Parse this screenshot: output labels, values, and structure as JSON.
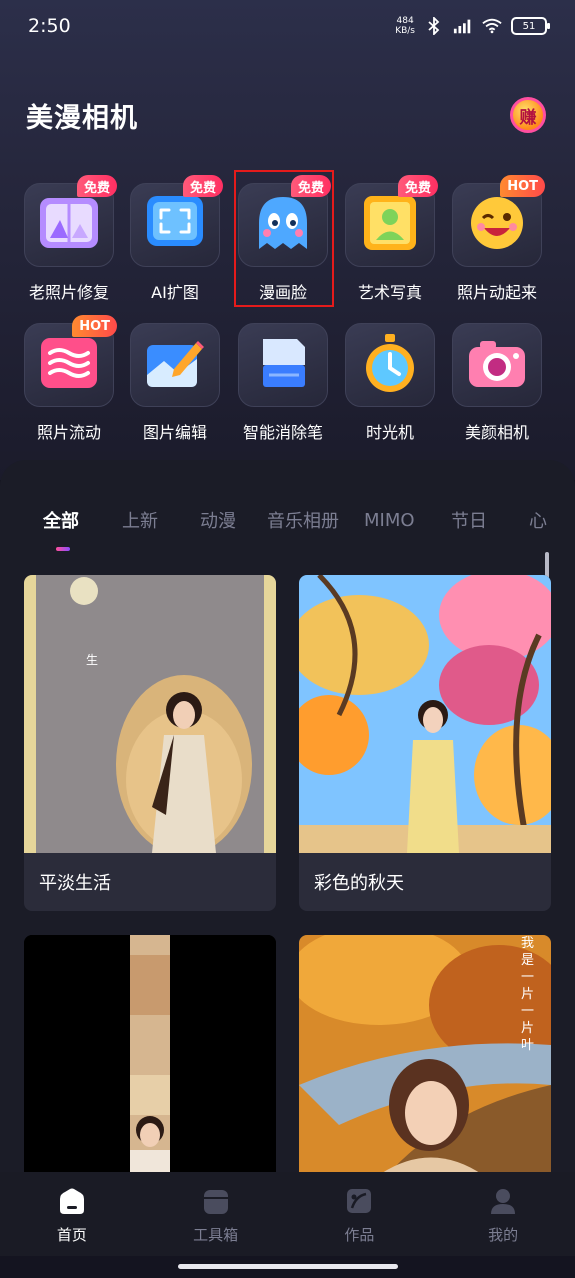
{
  "status_bar": {
    "time": "2:50",
    "net_speed_value": "484",
    "net_speed_unit": "KB/s",
    "battery": "51"
  },
  "app": {
    "title": "美漫相机",
    "earn_label": "赚"
  },
  "tools": [
    {
      "label": "老照片修复",
      "tag": "免费",
      "tag_type": "free",
      "icon": "old-photo-icon"
    },
    {
      "label": "AI扩图",
      "tag": "免费",
      "tag_type": "free",
      "icon": "expand-icon"
    },
    {
      "label": "漫画脸",
      "tag": "免费",
      "tag_type": "free",
      "icon": "ghost-icon"
    },
    {
      "label": "艺术写真",
      "tag": "免费",
      "tag_type": "free",
      "icon": "portrait-frame-icon"
    },
    {
      "label": "照片动起来",
      "tag": "HOT",
      "tag_type": "hot",
      "icon": "wink-face-icon"
    },
    {
      "label": "照片流动",
      "tag": "HOT",
      "tag_type": "hot",
      "icon": "waves-icon"
    },
    {
      "label": "图片编辑",
      "tag": "",
      "tag_type": "",
      "icon": "pencil-edit-icon"
    },
    {
      "label": "智能消除笔",
      "tag": "",
      "tag_type": "",
      "icon": "eraser-icon"
    },
    {
      "label": "时光机",
      "tag": "",
      "tag_type": "",
      "icon": "stopwatch-icon"
    },
    {
      "label": "美颜相机",
      "tag": "",
      "tag_type": "",
      "icon": "camera-icon"
    }
  ],
  "tabs": [
    "全部",
    "上新",
    "动漫",
    "音乐相册",
    "MIMO",
    "节日",
    "心"
  ],
  "active_tab": "全部",
  "cards": [
    {
      "title": "平淡生活"
    },
    {
      "title": "彩色的秋天"
    },
    {
      "title": ""
    },
    {
      "title": ""
    }
  ],
  "card_overlay_texts": {
    "card1": "生",
    "card4": "我是一片一片叶"
  },
  "bottom_nav": [
    {
      "label": "首页",
      "icon": "home-icon",
      "active": true
    },
    {
      "label": "工具箱",
      "icon": "toolbox-icon",
      "active": false
    },
    {
      "label": "作品",
      "icon": "works-icon",
      "active": false
    },
    {
      "label": "我的",
      "icon": "profile-icon",
      "active": false
    }
  ],
  "colors": {
    "accent_pink": "#ff2f62",
    "hot_orange": "#ff8a30",
    "highlight_red": "#e51b1b",
    "background": "#141420"
  }
}
